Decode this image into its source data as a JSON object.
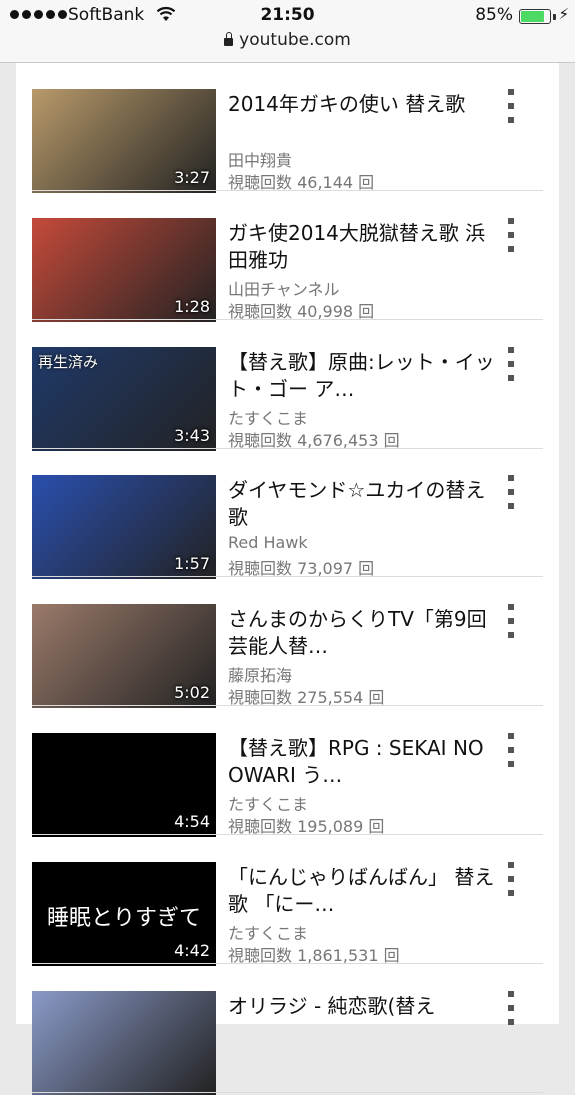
{
  "status_bar": {
    "carrier": "SoftBank",
    "time": "21:50",
    "battery": "85%",
    "battery_level": 0.85
  },
  "browser": {
    "url": "youtube.com"
  },
  "videos": [
    {
      "title": "2014年ガキの使い 替え歌",
      "channel": "田中翔貴",
      "views": "視聴回数 46,144 回",
      "duration": "3:27",
      "watched": "",
      "thumb_color": "#b89a6a"
    },
    {
      "title": "ガキ使2014大脱獄替え歌 浜田雅功",
      "channel": "山田チャンネル",
      "views": "視聴回数 40,998 回",
      "duration": "1:28",
      "watched": "",
      "thumb_color": "#c54a3a"
    },
    {
      "title": "【替え歌】原曲:レット・イット・ゴー ア…",
      "channel": "たすくこま",
      "views": "視聴回数 4,676,453 回",
      "duration": "3:43",
      "watched": "再生済み",
      "thumb_color": "#203a6a"
    },
    {
      "title": "ダイヤモンド☆ユカイの替え歌",
      "channel": "Red Hawk",
      "views": "視聴回数 73,097 回",
      "duration": "1:57",
      "watched": "",
      "thumb_color": "#2a4fae"
    },
    {
      "title": "さんまのからくりTV「第9回芸能人替…",
      "channel": "藤原拓海",
      "views": "視聴回数 275,554 回",
      "duration": "5:02",
      "watched": "",
      "thumb_color": "#9a7a6a"
    },
    {
      "title": "【替え歌】RPG : SEKAI NO OWARI う…",
      "channel": "たすくこま",
      "views": "視聴回数 195,089 回",
      "duration": "4:54",
      "watched": "",
      "thumb_color": "#000000"
    },
    {
      "title": "「にんじゃりばんばん」 替え歌 「にー…",
      "channel": "たすくこま",
      "views": "視聴回数 1,861,531 回",
      "duration": "4:42",
      "watched": "",
      "thumb_color": "#000000",
      "thumb_caption": "睡眠とりすぎて"
    },
    {
      "title": "オリラジ - 純恋歌(替え",
      "channel": "",
      "views": "",
      "duration": "",
      "watched": "",
      "thumb_color": "#8a9ac8"
    }
  ]
}
